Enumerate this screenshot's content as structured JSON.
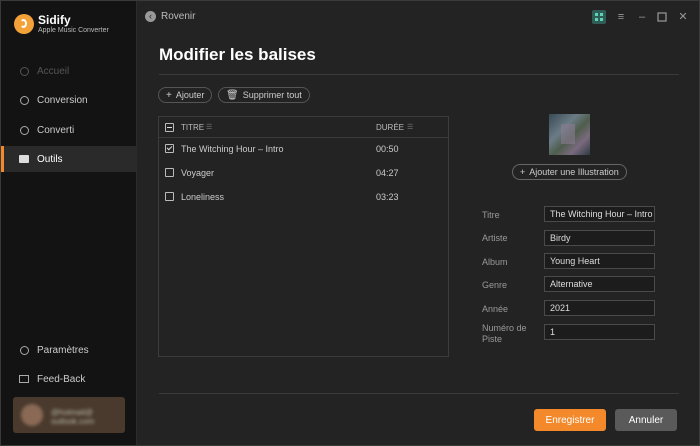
{
  "app": {
    "name": "Sidify",
    "subtitle": "Apple Music Converter"
  },
  "sidebar": {
    "items": [
      {
        "label": "Accueil",
        "icon": "home-icon",
        "state": "disabled"
      },
      {
        "label": "Conversion",
        "icon": "conversion-icon",
        "state": "normal"
      },
      {
        "label": "Converti",
        "icon": "clock-icon",
        "state": "normal"
      },
      {
        "label": "Outils",
        "icon": "toolbox-icon",
        "state": "active"
      }
    ],
    "bottom": [
      {
        "label": "Paramètres",
        "icon": "settings-icon"
      },
      {
        "label": "Feed-Back",
        "icon": "mail-icon"
      }
    ],
    "account": {
      "email": "@hotmail@ outlook.com"
    }
  },
  "header": {
    "back_label": "Rovenir"
  },
  "page": {
    "title": "Modifier les balises"
  },
  "toolbar": {
    "add_label": "Ajouter",
    "delete_all_label": "Supprimer tout"
  },
  "table": {
    "columns": {
      "title": "TITRE",
      "duration": "DURÉE"
    },
    "rows": [
      {
        "title": "The Witching Hour – Intro",
        "duration": "00:50",
        "checked": true
      },
      {
        "title": "Voyager",
        "duration": "04:27",
        "checked": false
      },
      {
        "title": "Loneliness",
        "duration": "03:23",
        "checked": false
      }
    ]
  },
  "artwork": {
    "add_button": "Ajouter une Illustration"
  },
  "fields": {
    "title": {
      "label": "Titre",
      "value": "The Witching Hour – Intro"
    },
    "artist": {
      "label": "Artiste",
      "value": "Birdy"
    },
    "album": {
      "label": "Album",
      "value": "Young Heart"
    },
    "genre": {
      "label": "Genre",
      "value": "Alternative"
    },
    "year": {
      "label": "Année",
      "value": "2021"
    },
    "track": {
      "label": "Numéro de Piste",
      "value": "1"
    }
  },
  "actions": {
    "save_label": "Enregistrer",
    "cancel_label": "Annuler"
  },
  "colors": {
    "accent": "#f3892b",
    "sidebar_bg": "#131313",
    "main_bg": "#232323"
  }
}
